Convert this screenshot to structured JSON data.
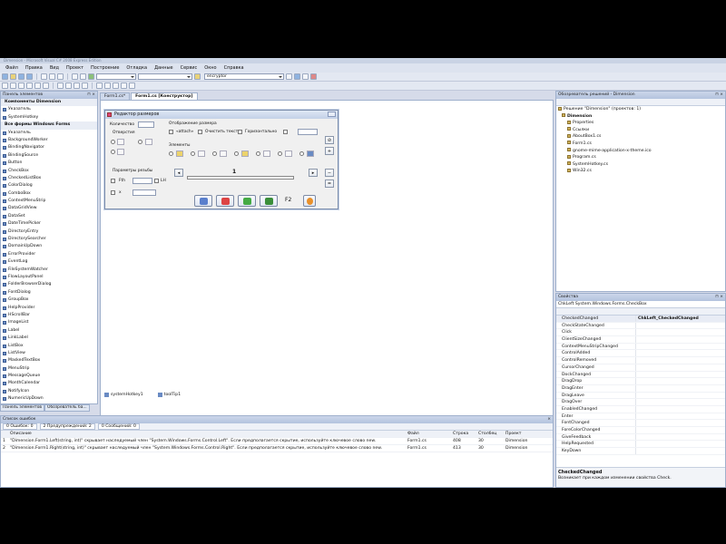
{
  "window_title": "Dimension - Microsoft Visual C# 2008 Express Edition",
  "menu": [
    "Файл",
    "Правка",
    "Вид",
    "Проект",
    "Построение",
    "Отладка",
    "Данные",
    "Сервис",
    "Окно",
    "Справка"
  ],
  "toolbar": {
    "config_combo": "Debug",
    "search_combo": "encryptor"
  },
  "toolbox": {
    "title": "Панель элементов",
    "items": [
      {
        "label": "Компоненты Dimension",
        "cat": true
      },
      {
        "label": "Указатель"
      },
      {
        "label": "SystemHotkey"
      },
      {
        "label": "Все формы Windows Forms",
        "cat": true
      },
      {
        "label": "Указатель"
      },
      {
        "label": "BackgroundWorker"
      },
      {
        "label": "BindingNavigator"
      },
      {
        "label": "BindingSource"
      },
      {
        "label": "Button"
      },
      {
        "label": "CheckBox"
      },
      {
        "label": "CheckedListBox"
      },
      {
        "label": "ColorDialog"
      },
      {
        "label": "ComboBox"
      },
      {
        "label": "ContextMenuStrip"
      },
      {
        "label": "DataGridView"
      },
      {
        "label": "DataSet"
      },
      {
        "label": "DateTimePicker"
      },
      {
        "label": "DirectoryEntry"
      },
      {
        "label": "DirectorySearcher"
      },
      {
        "label": "DomainUpDown"
      },
      {
        "label": "ErrorProvider"
      },
      {
        "label": "EventLog"
      },
      {
        "label": "FileSystemWatcher"
      },
      {
        "label": "FlowLayoutPanel"
      },
      {
        "label": "FolderBrowserDialog"
      },
      {
        "label": "FontDialog"
      },
      {
        "label": "GroupBox"
      },
      {
        "label": "HelpProvider"
      },
      {
        "label": "HScrollBar"
      },
      {
        "label": "ImageList"
      },
      {
        "label": "Label"
      },
      {
        "label": "LinkLabel"
      },
      {
        "label": "ListBox"
      },
      {
        "label": "ListView"
      },
      {
        "label": "MaskedTextBox"
      },
      {
        "label": "MenuStrip"
      },
      {
        "label": "MessageQueue"
      },
      {
        "label": "MonthCalendar"
      },
      {
        "label": "NotifyIcon"
      },
      {
        "label": "NumericUpDown"
      }
    ],
    "bottom_tabs": [
      "Панель элементов",
      "Обозреватель ба..."
    ]
  },
  "tabs": [
    "Form1.cs*",
    "Form1.cs [Конструктор]"
  ],
  "form": {
    "title": "Редактор размеров",
    "kolichestvo": "Количество",
    "otverstiya": "Отверстия",
    "otobrazhenie": "Отображение размера",
    "attach": "«attach»",
    "clear_text": "Очистить текст",
    "horizontal": "Горизонтально",
    "elements": "Элементы",
    "thread_params": "Параметры резьбы",
    "fth": "Fth",
    "x": "x",
    "lh": "LH",
    "scale_value": "1",
    "f2": "F2"
  },
  "tray": [
    "systemHotkey1",
    "toolTip1"
  ],
  "error_list": {
    "title": "Список ошибок",
    "tabs": [
      "0 Ошибок: 0",
      "2 Предупреждений: 2",
      "0 Сообщений: 0"
    ],
    "headers": [
      "",
      "Описание",
      "Файл",
      "Строка",
      "Столбец",
      "Проект"
    ],
    "rows": [
      [
        "1",
        "\"Dimension.Form1.Left(string, int)\" скрывает наследуемый член \"System.Windows.Forms.Control.Left\". Если предполагается скрытие, используйте ключевое слово new.",
        "Form1.cs",
        "408",
        "30",
        "Dimension"
      ],
      [
        "2",
        "\"Dimension.Form1.Right(string, int)\" скрывает наследуемый член \"System.Windows.Forms.Control.Right\". Если предполагается скрытие, используйте ключевое слово new.",
        "Form1.cs",
        "413",
        "30",
        "Dimension"
      ]
    ]
  },
  "solution": {
    "title": "Обозреватель решений - Dimension",
    "items": [
      "Решение \"Dimension\"   (проектов: 1)",
      "Dimension",
      "Properties",
      "Ссылки",
      "AboutBox1.cs",
      "Form1.cs",
      "gnome-mime-application-x-theme.ico",
      "Program.cs",
      "SystemHotkey.cs",
      "Win32.cs"
    ]
  },
  "properties": {
    "title": "Свойства",
    "object": "ChkLeft System.Windows.Forms.CheckBox",
    "rows": [
      [
        "CheckedChanged",
        "ChkLeft_CheckedChanged"
      ],
      [
        "CheckStateChanged",
        ""
      ],
      [
        "Click",
        ""
      ],
      [
        "ClientSizeChanged",
        ""
      ],
      [
        "ContextMenuStripChanged",
        ""
      ],
      [
        "ControlAdded",
        ""
      ],
      [
        "ControlRemoved",
        ""
      ],
      [
        "CursorChanged",
        ""
      ],
      [
        "DockChanged",
        ""
      ],
      [
        "DragDrop",
        ""
      ],
      [
        "DragEnter",
        ""
      ],
      [
        "DragLeave",
        ""
      ],
      [
        "DragOver",
        ""
      ],
      [
        "EnabledChanged",
        ""
      ],
      [
        "Enter",
        ""
      ],
      [
        "FontChanged",
        ""
      ],
      [
        "ForeColorChanged",
        ""
      ],
      [
        "GiveFeedback",
        ""
      ],
      [
        "HelpRequested",
        ""
      ],
      [
        "KeyDown",
        ""
      ]
    ],
    "desc_title": "CheckedChanged",
    "desc_text": "Возникает при каждом изменении свойства Check."
  }
}
